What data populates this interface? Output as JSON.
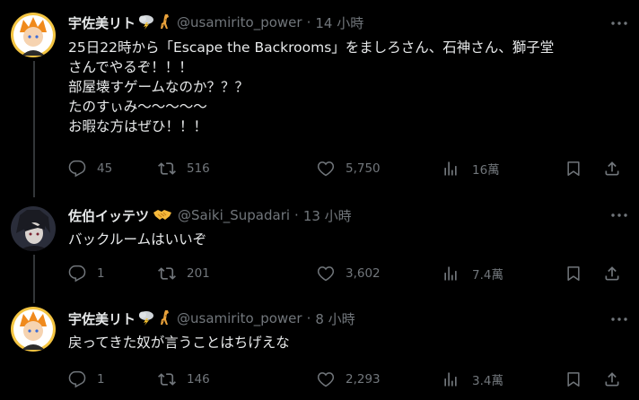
{
  "tweets": [
    {
      "display_name": "宇佐美リト",
      "badge_icons": [
        "thunder-cloud-icon",
        "giraffe-icon"
      ],
      "handle": "@usamirito_power",
      "time": "14 小時",
      "text": "25日22時から「Escape the Backrooms」をましろさん、石神さん、獅子堂\nさんでやるぞ！！！\n部屋壊すゲームなのか？？？\nたのすぃみ〜〜〜〜〜\nお暇な方はぜひ！！！",
      "replies": "45",
      "retweets": "516",
      "likes": "5,750",
      "views": "16萬"
    },
    {
      "display_name": "佐伯イッテツ",
      "badge_icons": [
        "handshake-icon"
      ],
      "handle": "@Saiki_Supadari",
      "time": "13 小時",
      "text": "バックルームはいいぞ",
      "replies": "1",
      "retweets": "201",
      "likes": "3,602",
      "views": "7.4萬"
    },
    {
      "display_name": "宇佐美リト",
      "badge_icons": [
        "thunder-cloud-icon",
        "giraffe-icon"
      ],
      "handle": "@usamirito_power",
      "time": "8 小時",
      "text": "戻ってきた奴が言うことはちげえな",
      "replies": "1",
      "retweets": "146",
      "likes": "2,293",
      "views": "3.4萬"
    }
  ],
  "colors": {
    "background": "#000000",
    "primary_text": "#e7e9ea",
    "secondary_text": "#71767b",
    "thread_line": "#333639"
  }
}
